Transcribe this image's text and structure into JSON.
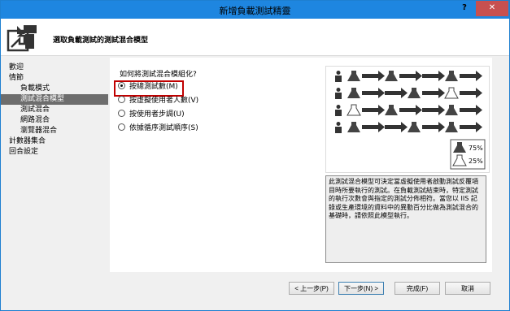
{
  "window": {
    "title": "新增負載測試精靈",
    "help": "?",
    "close": "✕"
  },
  "header": {
    "title": "選取負載測試的測試混合模型"
  },
  "nav": {
    "items": [
      {
        "label": "歡迎",
        "sub": false,
        "selected": false
      },
      {
        "label": "情節",
        "sub": false,
        "selected": false
      },
      {
        "label": "負載模式",
        "sub": true,
        "selected": false
      },
      {
        "label": "測試混合模型",
        "sub": true,
        "selected": true
      },
      {
        "label": "測試混合",
        "sub": true,
        "selected": false
      },
      {
        "label": "網路混合",
        "sub": true,
        "selected": false
      },
      {
        "label": "瀏覽器混合",
        "sub": true,
        "selected": false
      },
      {
        "label": "計數器集合",
        "sub": false,
        "selected": false
      },
      {
        "label": "回合設定",
        "sub": false,
        "selected": false
      }
    ]
  },
  "main": {
    "question": "如何將測試混合模組化?",
    "options": [
      {
        "label": "按總測試數(M)",
        "checked": true
      },
      {
        "label": "按虛擬使用者人數(V)",
        "checked": false
      },
      {
        "label": "按使用者步調(U)",
        "checked": false
      },
      {
        "label": "依據循序測試順序(S)",
        "checked": false
      }
    ],
    "legend": {
      "first": "75%",
      "second": "25%"
    },
    "description": "此測試混合模型可決定當虛擬使用者啟動測試反覆項目時所要執行的測試。在負載測試結束時，特定測試的執行次數會與指定的測試分佈相符。當您以 IIS 記錄或生產環境的資料中的異動百分比做為測試混合的基礎時，請依照此模型執行。"
  },
  "buttons": {
    "back": "< 上一步(P)",
    "next": "下一步(N) >",
    "finish": "完成(F)",
    "cancel": "取消"
  },
  "colors": {
    "titlebar": "#1e86e0",
    "close": "#c75050",
    "highlight": "#c00000",
    "nav_selected": "#6d6d6d"
  }
}
